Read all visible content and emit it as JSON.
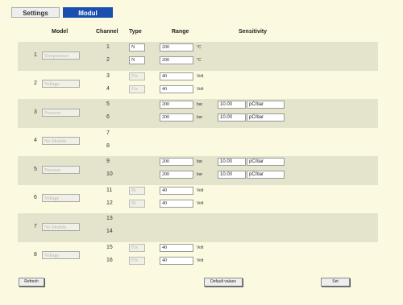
{
  "tabs": {
    "settings": "Settings",
    "modul": "Modul"
  },
  "headers": {
    "model": "Model",
    "channel": "Channel",
    "type": "Type",
    "range": "Range",
    "sensitivity": "Sensitivity"
  },
  "modules": [
    {
      "num": "1",
      "name": "Temperature",
      "channels": [
        {
          "ch": "1",
          "type": "N",
          "range": "200",
          "unit": "°C"
        },
        {
          "ch": "2",
          "type": "N",
          "range": "200",
          "unit": "°C"
        }
      ]
    },
    {
      "num": "2",
      "name": "Voltage",
      "channels": [
        {
          "ch": "3",
          "type": "Fix",
          "range": "40",
          "unit": "Volt"
        },
        {
          "ch": "4",
          "type": "Fix",
          "range": "40",
          "unit": "Volt"
        }
      ]
    },
    {
      "num": "3",
      "name": "Pressure",
      "channels": [
        {
          "ch": "5",
          "range": "200",
          "unit": "bar",
          "sens": "10.00",
          "sens_unit": "pC/bar"
        },
        {
          "ch": "6",
          "range": "200",
          "unit": "bar",
          "sens": "10.00",
          "sens_unit": "pC/bar"
        }
      ]
    },
    {
      "num": "4",
      "name": "No Module",
      "channels": [
        {
          "ch": "7"
        },
        {
          "ch": "8"
        }
      ]
    },
    {
      "num": "5",
      "name": "Pressure",
      "channels": [
        {
          "ch": "9",
          "range": "200",
          "unit": "bar",
          "sens": "10.00",
          "sens_unit": "pC/bar"
        },
        {
          "ch": "10",
          "range": "200",
          "unit": "bar",
          "sens": "10.00",
          "sens_unit": "pC/bar"
        }
      ]
    },
    {
      "num": "6",
      "name": "Voltage",
      "channels": [
        {
          "ch": "11",
          "type": "Bi",
          "range": "40",
          "unit": "Volt"
        },
        {
          "ch": "12",
          "type": "Bi",
          "range": "40",
          "unit": "Volt"
        }
      ]
    },
    {
      "num": "7",
      "name": "No Module",
      "channels": [
        {
          "ch": "13"
        },
        {
          "ch": "14"
        }
      ]
    },
    {
      "num": "8",
      "name": "Voltage",
      "channels": [
        {
          "ch": "15",
          "type": "Fix",
          "range": "40",
          "unit": "Volt"
        },
        {
          "ch": "16",
          "type": "Fix",
          "range": "40",
          "unit": "Volt"
        }
      ]
    }
  ],
  "buttons": {
    "refresh": "Refresh",
    "defaults": "Default values",
    "set": "Set"
  }
}
